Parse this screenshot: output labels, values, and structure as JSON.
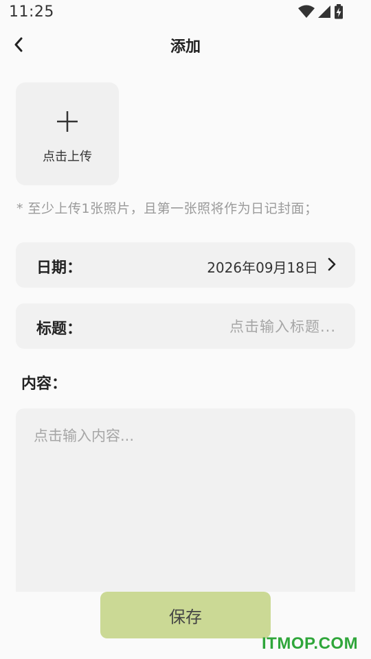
{
  "status_bar": {
    "time": "11:25",
    "icons": [
      "wifi-icon",
      "signal-icon",
      "battery-charging-icon"
    ]
  },
  "nav": {
    "title": "添加",
    "back_icon": "chevron-left-icon"
  },
  "upload": {
    "icon": "plus-icon",
    "label": "点击上传"
  },
  "hint": "*  至少上传1张照片，且第一张照将作为日记封面；",
  "date_row": {
    "label": "日期：",
    "value": "2026年09月18日",
    "icon": "chevron-right-icon"
  },
  "title_row": {
    "label": "标题：",
    "placeholder": "点击输入标题...",
    "value": ""
  },
  "content": {
    "label": "内容：",
    "placeholder": "点击输入内容...",
    "value": ""
  },
  "save_button": {
    "label": "保存",
    "color": "#cbd995"
  },
  "watermark": {
    "text": "ITMOP.COM",
    "color": "#2fa63a"
  }
}
